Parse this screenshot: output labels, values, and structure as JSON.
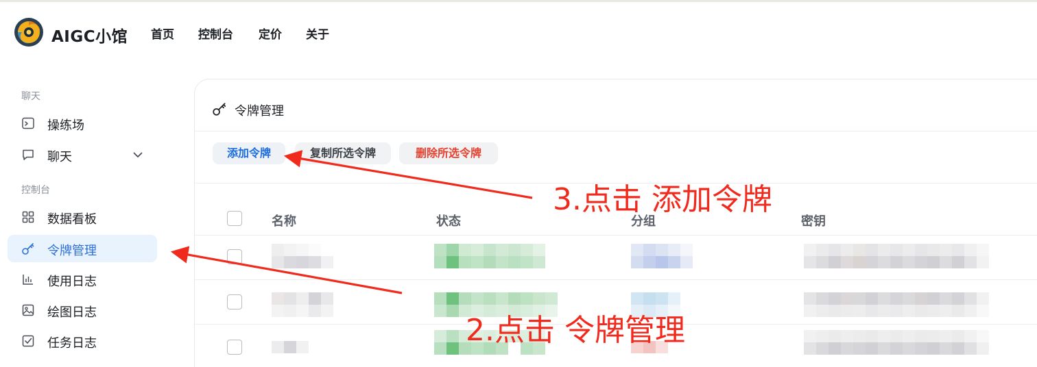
{
  "header": {
    "brand": "AIGC小馆",
    "nav": [
      "首页",
      "控制台",
      "定价",
      "关于"
    ]
  },
  "sidebar": {
    "sections": [
      {
        "label": "聊天",
        "items": [
          {
            "label": "操练场",
            "icon": "terminal-icon"
          },
          {
            "label": "聊天",
            "icon": "chat-bubble-icon",
            "has_dropdown": true
          }
        ]
      },
      {
        "label": "控制台",
        "items": [
          {
            "label": "数据看板",
            "icon": "dashboard-grid-icon"
          },
          {
            "label": "令牌管理",
            "icon": "key-icon",
            "active": true
          },
          {
            "label": "使用日志",
            "icon": "bar-chart-icon"
          },
          {
            "label": "绘图日志",
            "icon": "image-icon"
          },
          {
            "label": "任务日志",
            "icon": "checkbox-task-icon"
          }
        ]
      }
    ]
  },
  "main": {
    "title": "令牌管理",
    "title_icon": "key-icon",
    "buttons": {
      "add": "添加令牌",
      "copy": "复制所选令牌",
      "delete": "删除所选令牌"
    },
    "table": {
      "columns": [
        "名称",
        "状态",
        "分组",
        "密钥"
      ],
      "rows_blurred": 3
    }
  },
  "annotations": {
    "step3": "3.点击 添加令牌",
    "step2": "2.点击 令牌管理"
  },
  "colors": {
    "accent": "#2d6fd6",
    "active_bg": "#e8f3fe",
    "annotation_red": "#f02a1c",
    "delete_red": "#e8402e"
  }
}
